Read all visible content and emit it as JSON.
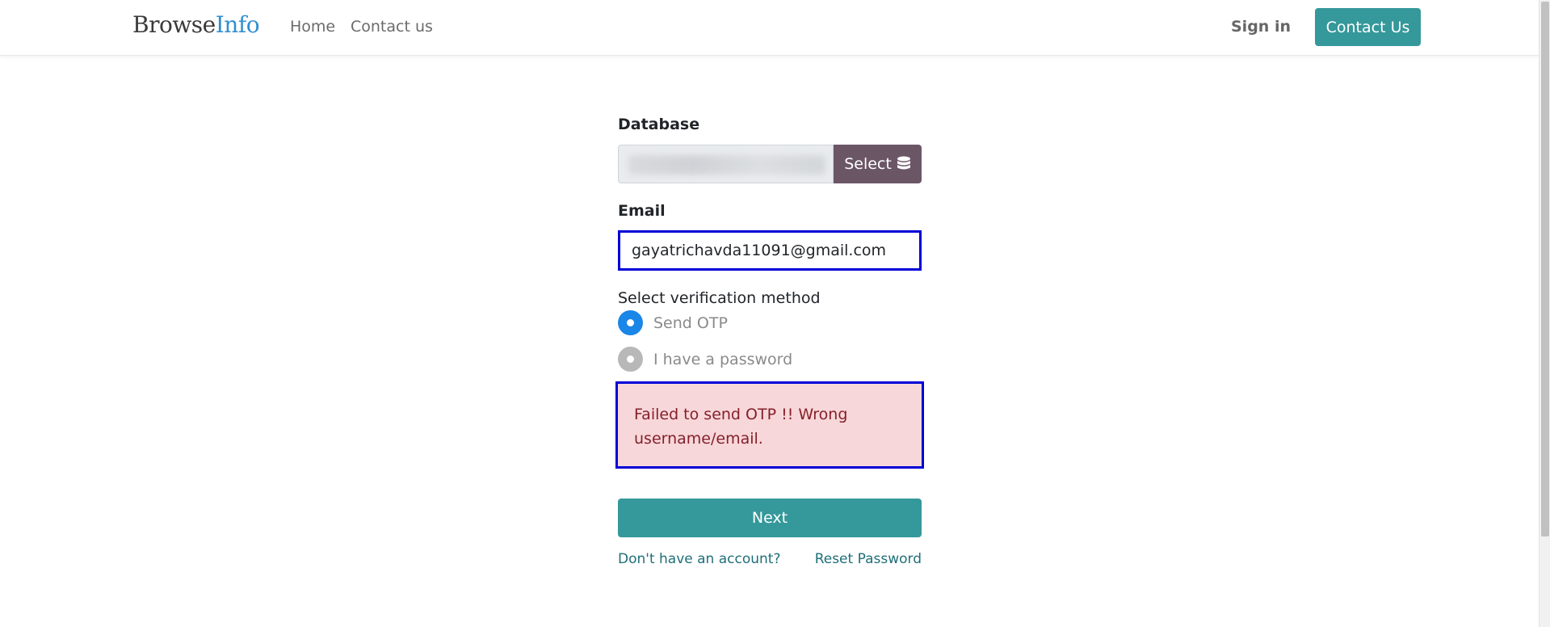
{
  "brand": {
    "part1": "Browse",
    "part2": "Info"
  },
  "nav": {
    "home": "Home",
    "contact": "Contact us"
  },
  "header": {
    "signin": "Sign in",
    "contact_button": "Contact Us"
  },
  "form": {
    "database_label": "Database",
    "database_value": "",
    "select_button": "Select",
    "email_label": "Email",
    "email_value": "gayatrichavda11091@gmail.com",
    "verification_label": "Select verification method",
    "options": [
      {
        "label": "Send OTP",
        "checked": true
      },
      {
        "label": "I have a password",
        "checked": false
      }
    ],
    "alert": "Failed to send OTP !! Wrong username/email.",
    "next_button": "Next",
    "signup_link": "Don't have an account?",
    "reset_link": "Reset Password"
  },
  "colors": {
    "accent": "#35989a",
    "select_button": "#6b5666",
    "alert_bg": "#f8d7da",
    "alert_text": "#842029",
    "highlight_border": "#0000d6",
    "radio_checked": "#1a86e8"
  },
  "icons": {
    "select": "database-icon"
  }
}
